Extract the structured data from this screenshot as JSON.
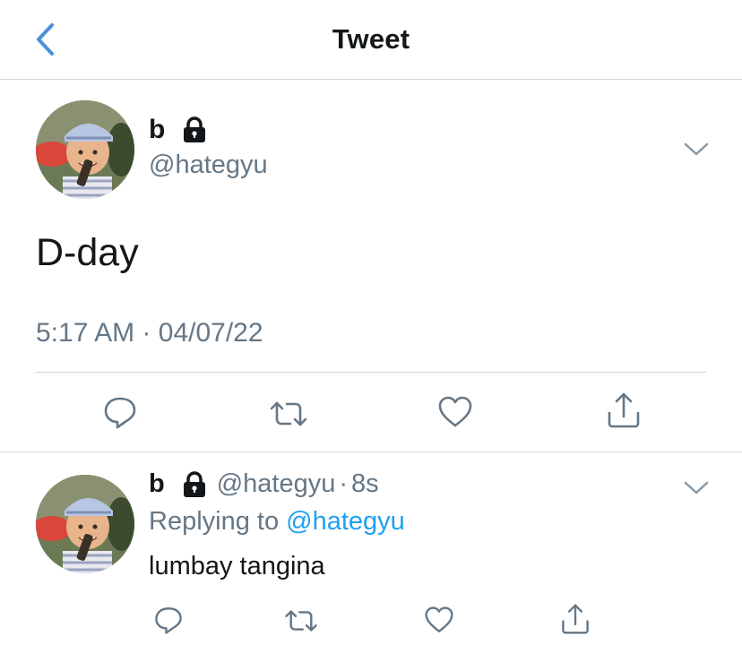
{
  "nav": {
    "title": "Tweet",
    "back_icon": "chevron-left-icon"
  },
  "tweet": {
    "name": "b",
    "handle": "@hategyu",
    "text": "D-day",
    "time": "5:17 AM",
    "separator": "·",
    "date": "04/07/22",
    "icons": [
      "lock-icon",
      "chevron-down-icon"
    ],
    "actions": [
      "reply-icon",
      "retweet-icon",
      "like-icon",
      "share-icon"
    ]
  },
  "reply": {
    "name": "b",
    "handle": "@hategyu",
    "separator": "·",
    "age": "8s",
    "replying_prefix": "Replying to",
    "replying_handle": "@hategyu",
    "text": "lumbay tangina",
    "actions": [
      "reply-icon",
      "retweet-icon",
      "like-icon",
      "share-icon"
    ]
  },
  "colors": {
    "accent": "#4a90d9",
    "link": "#1da1f2",
    "muted": "#657786",
    "text": "#14171a",
    "divider": "#d6d6d6"
  }
}
